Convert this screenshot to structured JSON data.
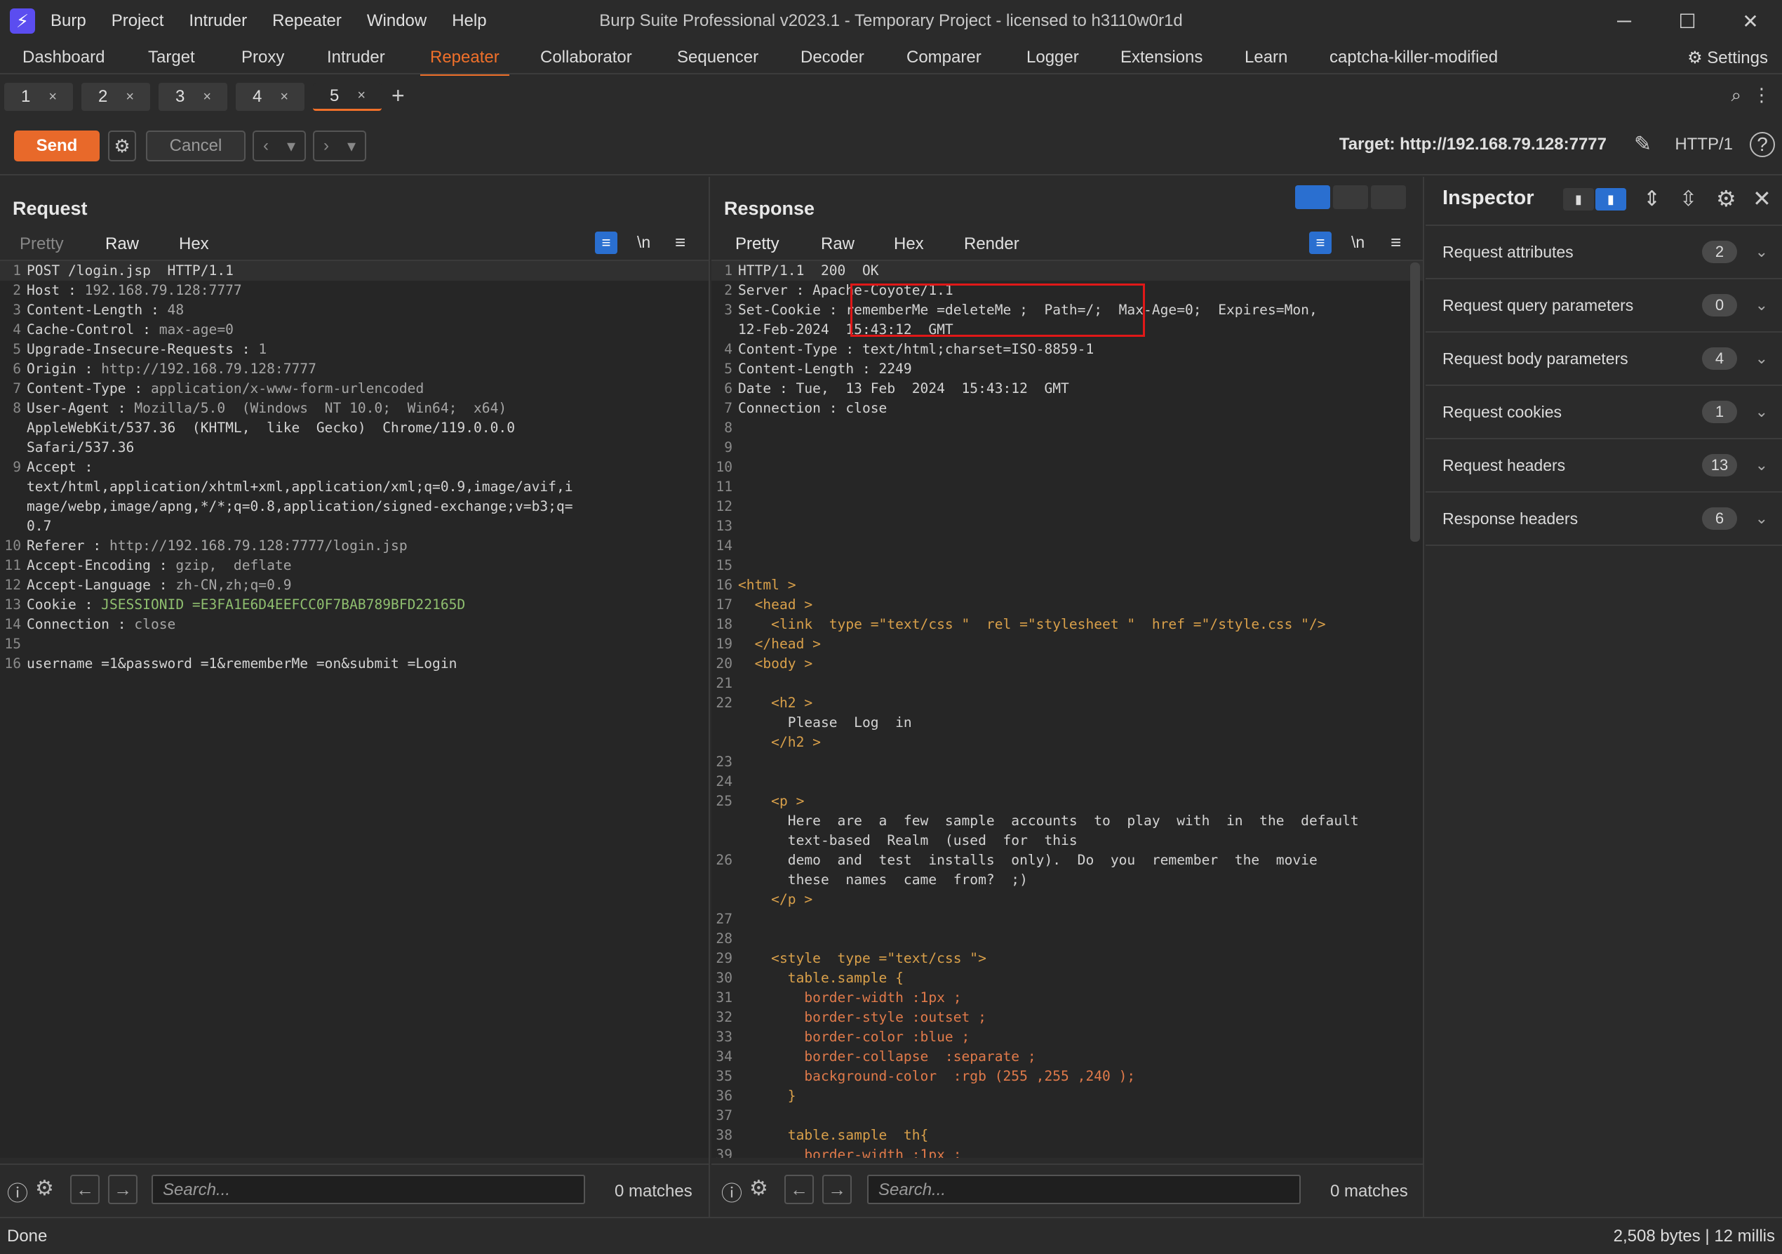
{
  "window": {
    "title": "Burp Suite Professional v2023.1 - Temporary Project - licensed to h3110w0r1d",
    "menu": [
      "Burp",
      "Project",
      "Intruder",
      "Repeater",
      "Window",
      "Help"
    ],
    "controls": {
      "minimize": "─",
      "maximize": "☐",
      "close": "✕"
    }
  },
  "nav": {
    "tabs": [
      "Dashboard",
      "Target",
      "Proxy",
      "Intruder",
      "Repeater",
      "Collaborator",
      "Sequencer",
      "Decoder",
      "Comparer",
      "Logger",
      "Extensions",
      "Learn",
      "captcha-killer-modified"
    ],
    "active": "Repeater",
    "settings_label": "Settings"
  },
  "repeater_tabs": {
    "tabs": [
      "1",
      "2",
      "3",
      "4",
      "5"
    ],
    "active": "5",
    "close_glyph": "×",
    "add_glyph": "+"
  },
  "toolbar": {
    "send_label": "Send",
    "cancel_label": "Cancel",
    "target": "Target: http://192.168.79.128:7777",
    "http_version": "HTTP/1"
  },
  "request": {
    "title": "Request",
    "tabs": [
      "Pretty",
      "Raw",
      "Hex"
    ],
    "active_tab": "Raw",
    "newline_label": "\\n",
    "lines": [
      {
        "n": "1",
        "k": "POST /login.jsp  HTTP/1.1",
        "v": ""
      },
      {
        "n": "2",
        "k": "Host",
        "v": "192.168.79.128:7777"
      },
      {
        "n": "3",
        "k": "Content-Length",
        "v": "48"
      },
      {
        "n": "4",
        "k": "Cache-Control",
        "v": "max-age=0"
      },
      {
        "n": "5",
        "k": "Upgrade-Insecure-Requests",
        "v": "1"
      },
      {
        "n": "6",
        "k": "Origin",
        "v": "http://192.168.79.128:7777"
      },
      {
        "n": "7",
        "k": "Content-Type",
        "v": "application/x-www-form-urlencoded"
      },
      {
        "n": "8",
        "k": "User-Agent",
        "v": "Mozilla/5.0  (Windows  NT 10.0;  Win64;  x64)"
      },
      {
        "n": "",
        "k": "AppleWebKit/537.36  (KHTML,  like  Gecko)  Chrome/119.0.0.0",
        "v": ""
      },
      {
        "n": "",
        "k": "Safari/537.36",
        "v": ""
      },
      {
        "n": "9",
        "k": "Accept",
        "v": ""
      },
      {
        "n": "",
        "k": "text/html,application/xhtml+xml,application/xml;q=0.9,image/avif,i",
        "v": ""
      },
      {
        "n": "",
        "k": "mage/webp,image/apng,*/*;q=0.8,application/signed-exchange;v=b3;q=",
        "v": ""
      },
      {
        "n": "",
        "k": "0.7",
        "v": ""
      },
      {
        "n": "10",
        "k": "Referer",
        "v": "http://192.168.79.128:7777/login.jsp"
      },
      {
        "n": "11",
        "k": "Accept-Encoding",
        "v": "gzip,  deflate"
      },
      {
        "n": "12",
        "k": "Accept-Language",
        "v": "zh-CN,zh;q=0.9"
      },
      {
        "n": "13",
        "k": "Cookie",
        "v": "JSESSIONID =E3FA1E6D4EEFCC0F7BAB789BFD22165D"
      },
      {
        "n": "14",
        "k": "Connection",
        "v": "close"
      },
      {
        "n": "15",
        "k": "",
        "v": ""
      },
      {
        "n": "16",
        "k": "username =1&password =1&rememberMe =on&submit =Login",
        "v": ""
      }
    ]
  },
  "response": {
    "title": "Response",
    "tabs": [
      "Pretty",
      "Raw",
      "Hex",
      "Render"
    ],
    "active_tab": "Pretty",
    "newline_label": "\\n",
    "lines": [
      {
        "n": "1",
        "t": "HTTP/1.1  200  OK"
      },
      {
        "n": "2",
        "t": "Server : Apache-Coyote/1.1"
      },
      {
        "n": "3",
        "t": "Set-Cookie : rememberMe =deleteMe ;  Path=/;  Max-Age=0;  Expires=Mon,"
      },
      {
        "n": "",
        "t": "12-Feb-2024  15:43:12  GMT"
      },
      {
        "n": "4",
        "t": "Content-Type : text/html;charset=ISO-8859-1"
      },
      {
        "n": "5",
        "t": "Content-Length : 2249"
      },
      {
        "n": "6",
        "t": "Date : Tue,  13 Feb  2024  15:43:12  GMT"
      },
      {
        "n": "7",
        "t": "Connection : close"
      },
      {
        "n": "8",
        "t": ""
      },
      {
        "n": "9",
        "t": ""
      },
      {
        "n": "10",
        "t": ""
      },
      {
        "n": "11",
        "t": ""
      },
      {
        "n": "12",
        "t": ""
      },
      {
        "n": "13",
        "t": ""
      },
      {
        "n": "14",
        "t": ""
      },
      {
        "n": "15",
        "t": ""
      },
      {
        "n": "16",
        "t": "<html >"
      },
      {
        "n": "17",
        "t": "  <head >"
      },
      {
        "n": "18",
        "t": "    <link  type =\"text/css \"  rel =\"stylesheet \"  href =\"/style.css \"/>"
      },
      {
        "n": "19",
        "t": "  </head >"
      },
      {
        "n": "20",
        "t": "  <body >"
      },
      {
        "n": "21",
        "t": ""
      },
      {
        "n": "22",
        "t": "    <h2 >"
      },
      {
        "n": "",
        "t": "      Please  Log  in"
      },
      {
        "n": "",
        "t": "    </h2 >"
      },
      {
        "n": "23",
        "t": ""
      },
      {
        "n": "24",
        "t": ""
      },
      {
        "n": "25",
        "t": "    <p >"
      },
      {
        "n": "",
        "t": "      Here  are  a  few  sample  accounts  to  play  with  in  the  default"
      },
      {
        "n": "",
        "t": "      text-based  Realm  (used  for  this"
      },
      {
        "n": "26",
        "t": "      demo  and  test  installs  only).  Do  you  remember  the  movie"
      },
      {
        "n": "",
        "t": "      these  names  came  from?  ;)"
      },
      {
        "n": "",
        "t": "    </p >"
      },
      {
        "n": "27",
        "t": ""
      },
      {
        "n": "28",
        "t": ""
      },
      {
        "n": "29",
        "t": "    <style  type =\"text/css \">"
      },
      {
        "n": "30",
        "t": "      table.sample {"
      },
      {
        "n": "31",
        "t": "        border-width :1px ;"
      },
      {
        "n": "32",
        "t": "        border-style :outset ;"
      },
      {
        "n": "33",
        "t": "        border-color :blue ;"
      },
      {
        "n": "34",
        "t": "        border-collapse  :separate ;"
      },
      {
        "n": "35",
        "t": "        background-color  :rgb (255 ,255 ,240 );"
      },
      {
        "n": "36",
        "t": "      }"
      },
      {
        "n": "37",
        "t": ""
      },
      {
        "n": "38",
        "t": "      table.sample  th{"
      },
      {
        "n": "39",
        "t": "        border-width :1px ;"
      }
    ]
  },
  "search": {
    "placeholder": "Search...",
    "matches": "0 matches"
  },
  "inspector": {
    "title": "Inspector",
    "sections": [
      {
        "label": "Request attributes",
        "count": "2"
      },
      {
        "label": "Request query parameters",
        "count": "0"
      },
      {
        "label": "Request body parameters",
        "count": "4"
      },
      {
        "label": "Request cookies",
        "count": "1"
      },
      {
        "label": "Request headers",
        "count": "13"
      },
      {
        "label": "Response headers",
        "count": "6"
      }
    ]
  },
  "status": {
    "left": "Done",
    "right": "2,508 bytes | 12 millis"
  },
  "colors": {
    "accent": "#f0702a",
    "send": "#e8692a",
    "highlight_box": "#e01818",
    "toggle_on": "#2a6fd0"
  }
}
